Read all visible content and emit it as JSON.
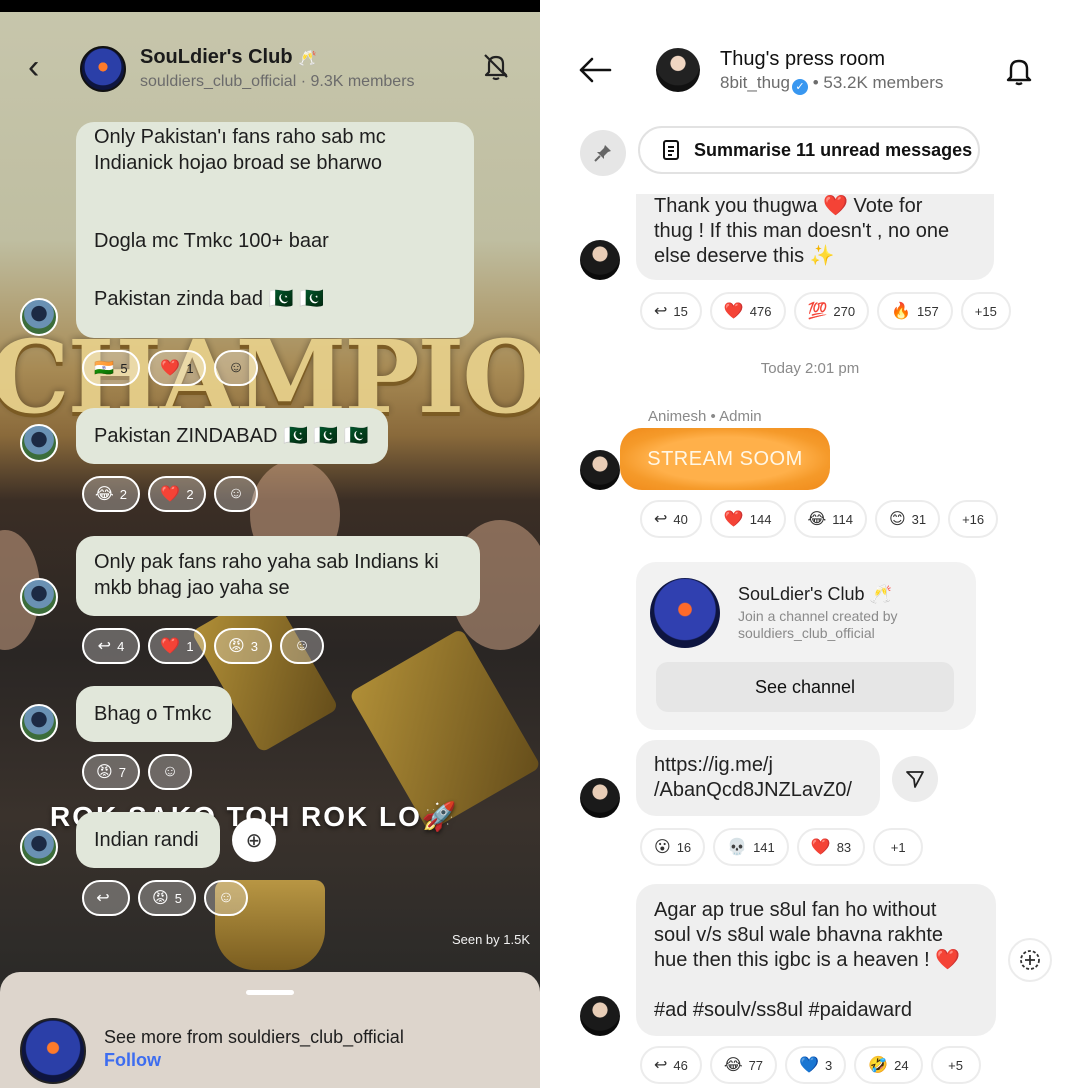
{
  "left": {
    "header": {
      "title": "SouLdier's Club",
      "title_emoji": "🥂",
      "handle": "souldiers_club_official",
      "members": "9.3K members"
    },
    "background": {
      "banner": "CHAMPIONS",
      "slogan": "ROK SAKO TOH ROK LO🚀",
      "seen": "Seen by 1.5K"
    },
    "messages": [
      {
        "lines": [
          "Only Pakistan'ı fans raho sab mc",
          "Indianick hojao broad se bharwo",
          "",
          "",
          "Dogla mc Tmkc 100+ baar",
          "",
          "Pakistan zinda bad 🇵🇰 🇵🇰"
        ],
        "reactions": [
          {
            "emoji": "🇮🇳",
            "count": "5"
          },
          {
            "emoji": "❤️",
            "count": "1"
          }
        ]
      },
      {
        "lines": [
          "Pakistan ZINDABAD 🇵🇰 🇵🇰 🇵🇰"
        ],
        "reactions": [
          {
            "emoji": "😂",
            "count": "2"
          },
          {
            "emoji": "❤️",
            "count": "2"
          }
        ]
      },
      {
        "lines": [
          "Only pak fans raho yaha sab Indians ki",
          "mkb bhag jao yaha se"
        ],
        "reactions": [
          {
            "emoji": "↩",
            "count": "4"
          },
          {
            "emoji": "❤️",
            "count": "1"
          },
          {
            "emoji": "😡",
            "count": "3"
          }
        ]
      },
      {
        "lines": [
          "Bhag o Tmkc"
        ],
        "reactions": [
          {
            "emoji": "😡",
            "count": "7"
          }
        ]
      },
      {
        "lines": [
          "Indian randi"
        ],
        "reactions": [
          {
            "emoji": "↩",
            "count": ""
          },
          {
            "emoji": "😡",
            "count": "5"
          }
        ]
      }
    ],
    "bottom": {
      "text": "See more from souldiers_club_official",
      "follow": "Follow"
    }
  },
  "right": {
    "header": {
      "title": "Thug's press room",
      "handle": "8bit_thug",
      "members": "• 53.2K members"
    },
    "summarise": "Summarise 11 unread messages",
    "msg1": {
      "lines": [
        "Thank you thugwa ❤️ Vote for",
        "thug ! If this man doesn't  , no one",
        "else deserve this ✨"
      ],
      "reactions": [
        {
          "emoji": "↩",
          "count": "15"
        },
        {
          "emoji": "❤️",
          "count": "476"
        },
        {
          "emoji": "💯",
          "count": "270"
        },
        {
          "emoji": "🔥",
          "count": "157"
        },
        {
          "emoji": "",
          "count": "+15"
        }
      ]
    },
    "timestamp": "Today 2:01 pm",
    "sender": "Animesh • Admin",
    "sticker": "STREAM SOOM",
    "msg2": {
      "reactions": [
        {
          "emoji": "↩",
          "count": "40"
        },
        {
          "emoji": "❤️",
          "count": "144"
        },
        {
          "emoji": "😂",
          "count": "114"
        },
        {
          "emoji": "😊",
          "count": "31"
        },
        {
          "emoji": "",
          "count": "+16"
        }
      ]
    },
    "channel_card": {
      "title": "SouLdier's Club 🥂",
      "desc": "Join a channel created by souldiers_club_official",
      "button": "See channel"
    },
    "msg3": {
      "lines": [
        "https://ig.me/j",
        "/AbanQcd8JNZLavZ0/"
      ],
      "reactions": [
        {
          "emoji": "😮",
          "count": "16"
        },
        {
          "emoji": "💀",
          "count": "141"
        },
        {
          "emoji": "❤️",
          "count": "83"
        },
        {
          "emoji": "",
          "count": "+1"
        }
      ]
    },
    "msg4": {
      "lines": [
        "Agar ap true s8ul fan ho without",
        "soul v/s s8ul wale bhavna rakhte",
        "hue then this igbc is a heaven ! ❤️",
        "",
        "#ad #soulv/ss8ul #paidaward"
      ],
      "reactions": [
        {
          "emoji": "↩",
          "count": "46"
        },
        {
          "emoji": "😂",
          "count": "77"
        },
        {
          "emoji": "💙",
          "count": "3"
        },
        {
          "emoji": "🤣",
          "count": "24"
        },
        {
          "emoji": "",
          "count": "+5"
        }
      ]
    }
  },
  "colors": {
    "follow_blue": "#3d6df0",
    "verified_blue": "#3897f0",
    "sticker_orange": "#f59a2a",
    "heart_red": "#e0245e"
  }
}
